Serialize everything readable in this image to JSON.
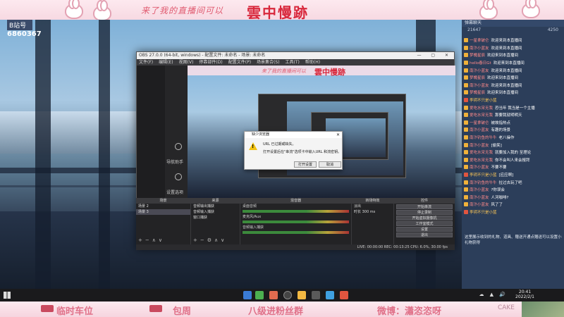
{
  "top_banner": {
    "text": "来了我的直播间可以",
    "name": "雲中慢跡"
  },
  "brand": {
    "logo": "B站号",
    "id": "6860367"
  },
  "obs": {
    "title": "OBS 27.0.0 (64-bit, windows) - 配置文件: 未命名 - 场景: 未命名",
    "menu": [
      "文件(F)",
      "编辑(E)",
      "视图(V)",
      "停靠部件(D)",
      "配置文件(P)",
      "场景集合(S)",
      "工具(T)",
      "帮助(H)"
    ],
    "side_items": [
      "导航助手",
      "设置选项"
    ],
    "preview": {
      "banner_text": "来了我的直播间可以",
      "banner_name": "雲中慢跡"
    },
    "dialog": {
      "title": "缺少浏览器",
      "line1": "URL 已过期或缺失。",
      "line2": "打开设置后在\"串流\"选项卡中输入URL 和流密钥。",
      "ok": "打开设置",
      "cancel": "取消"
    },
    "docks": {
      "scenes": {
        "header": "场景",
        "items": [
          "场景 2",
          "场景 3"
        ]
      },
      "sources": {
        "header": "来源",
        "items": [
          "音频输出捕获",
          "音频输入捕获",
          "窗口捕获"
        ]
      },
      "mixer": {
        "header": "混音器",
        "channels": [
          {
            "name": "桌面音频",
            "db": "0.0 dB"
          },
          {
            "name": "麦克风/Aux",
            "db": "0.0 dB"
          },
          {
            "name": "音频输入捕获",
            "db": "0.0 dB"
          }
        ]
      },
      "transitions": {
        "header": "转场特效",
        "type": "淡出",
        "duration_label": "时长",
        "duration": "300 ms"
      },
      "controls": {
        "header": "控件",
        "buttons": [
          "开始串流",
          "停止录制",
          "开始虚拟摄像机",
          "工作室模式",
          "设置",
          "退出"
        ]
      }
    },
    "status": "LIVE: 00:00:00    REC: 00:13:25    CPU: 6.0%, 30.00 fps"
  },
  "chat": {
    "header": "弹幕聊天",
    "stats": {
      "left": "21647",
      "right": "4250"
    },
    "messages": [
      {
        "name": "一星拿破仑",
        "text": "欢迎来到本直播间",
        "kind": "welcome"
      },
      {
        "name": "南汴小蓝友",
        "text": "欢迎来到本直播间",
        "kind": "welcome"
      },
      {
        "name": "梦魄星辰",
        "text": "欢迎来到本直播间",
        "kind": "welcome"
      },
      {
        "name": "hello春日Gt",
        "text": "欢迎来到本直播间",
        "kind": "welcome"
      },
      {
        "name": "南汴小蓝友",
        "text": "欢迎来到本直播间",
        "kind": "welcome"
      },
      {
        "name": "梦魄星辰",
        "text": "欢迎来到本直播间",
        "kind": "welcome"
      },
      {
        "name": "南汴小蓝友",
        "text": "欢迎来到本直播间",
        "kind": "welcome"
      },
      {
        "name": "梦魄星辰",
        "text": "欢迎来到本直播间",
        "kind": "welcome"
      },
      {
        "name": "李玥不只是小蓝",
        "text": "",
        "kind": "gift"
      },
      {
        "name": "爱吃水宋无我",
        "text": "恐当年 我当是一个主播",
        "kind": "chat"
      },
      {
        "name": "爱吃水宋无我",
        "text": "那要我就明明天",
        "kind": "chat"
      },
      {
        "name": "一星拿破仑",
        "text": "被故指热点",
        "kind": "chat"
      },
      {
        "name": "南汴小蓝友",
        "text": "有趣的场景",
        "kind": "chat"
      },
      {
        "name": "南汴钓鱼的牛牛",
        "text": "老八操作",
        "kind": "chat"
      },
      {
        "name": "南汴小蓝友",
        "text": "[偷笑]",
        "kind": "chat"
      },
      {
        "name": "爱吃水宋无我",
        "text": "就要加入我的 至理论",
        "kind": "chat"
      },
      {
        "name": "爱吃水宋无我",
        "text": "你不会叫人来会报拜",
        "kind": "chat"
      },
      {
        "name": "南汴小蓝友",
        "text": "不要不要",
        "kind": "chat"
      },
      {
        "name": "李玥不只是小蓝",
        "text": "[应应啊]",
        "kind": "gift"
      },
      {
        "name": "南汴钓鱼的牛牛",
        "text": "拉过去玩了吧",
        "kind": "chat"
      },
      {
        "name": "南汴小蓝友",
        "text": "?你误会",
        "kind": "chat"
      },
      {
        "name": "南汴小蓝友",
        "text": "人河咖啡?",
        "kind": "chat"
      },
      {
        "name": "南汴小蓝友",
        "text": "风了了",
        "kind": "chat"
      },
      {
        "name": "李玥不只是小蓝",
        "text": "",
        "kind": "gift"
      }
    ],
    "notice": "这里展示收到的礼物、道具、赠送开通点赠送可以设置小礼物获得"
  },
  "taskbar": {
    "time": "20:41",
    "date": "2022/2/1"
  },
  "bottom_banner": {
    "items": [
      "临时车位",
      "包周",
      "八级进粉丝群",
      "微博：瀟恣恣呀"
    ],
    "cake": "CAKE"
  },
  "colors": {
    "accent_red": "#d8283c",
    "banner_pink": "#fde9ef",
    "chat_bg": "#2c3e5a"
  }
}
